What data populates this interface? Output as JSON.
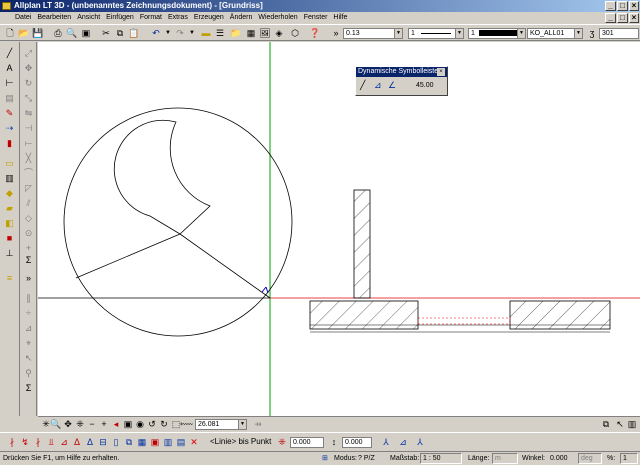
{
  "window": {
    "title": "Allplan LT 3D - (unbenanntes Zeichnungsdokument) - [Grundriss]"
  },
  "menu": [
    "Datei",
    "Bearbeiten",
    "Ansicht",
    "Einfügen",
    "Format",
    "Extras",
    "Erzeugen",
    "Ändern",
    "Wiederholen",
    "Fenster",
    "Hilfe"
  ],
  "toolbar": {
    "pen_thickness": "0.13",
    "line_type": "1",
    "color": "1",
    "layer": "KO_ALL01",
    "count": "301"
  },
  "palette": {
    "title": "Dynamische Symbolleiste",
    "angle_value": "45.00"
  },
  "nav": {
    "zoom_value": "26.081"
  },
  "input": {
    "prompt": "<Linie> bis Punkt",
    "dx_value": "0.000",
    "dy_value": "0.000"
  },
  "status": {
    "help": "Drücken Sie F1, um Hilfe zu erhalten.",
    "mode_label": "Modus:",
    "mode_value": "? P/Z",
    "scale_label": "Maßstab:",
    "scale_value": "1 : 50",
    "length_label": "Länge:",
    "length_unit": "m",
    "angle_label": "Winkel:",
    "angle_value": "0.000",
    "angle_unit": "deg",
    "percent_label": "%:",
    "percent_value": "1"
  },
  "colors": {
    "titlebar": "#0a246a",
    "canvas": "#ffffff",
    "axis_vertical": "#00a000",
    "axis_horizontal": "#e00000",
    "face": "#d4d0c8"
  }
}
